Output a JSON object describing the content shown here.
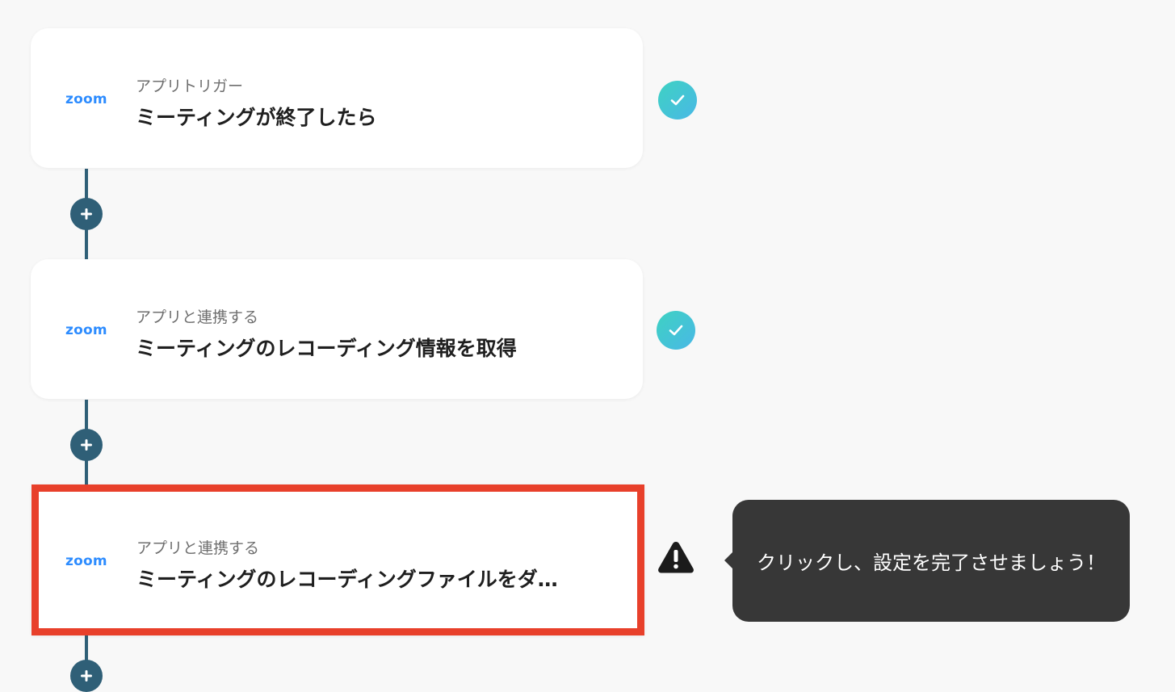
{
  "flow": {
    "steps": [
      {
        "app": "zoom",
        "label": "アプリトリガー",
        "title": "ミーティングが終了したら",
        "status": "complete"
      },
      {
        "app": "zoom",
        "label": "アプリと連携する",
        "title": "ミーティングのレコーディング情報を取得",
        "status": "complete"
      },
      {
        "app": "zoom",
        "label": "アプリと連携する",
        "title": "ミーティングのレコーディングファイルをダ…",
        "status": "warning"
      }
    ],
    "add_step_icon": "plus-icon"
  },
  "tooltip": {
    "text": "クリックし、設定を完了させましょう！"
  },
  "colors": {
    "connector": "#2f5f77",
    "highlight_border": "#e8402b",
    "zoom_brand": "#2d8cff",
    "tooltip_bg": "#373737",
    "status_ok_gradient": [
      "#3ed2c2",
      "#49b8e6"
    ]
  }
}
